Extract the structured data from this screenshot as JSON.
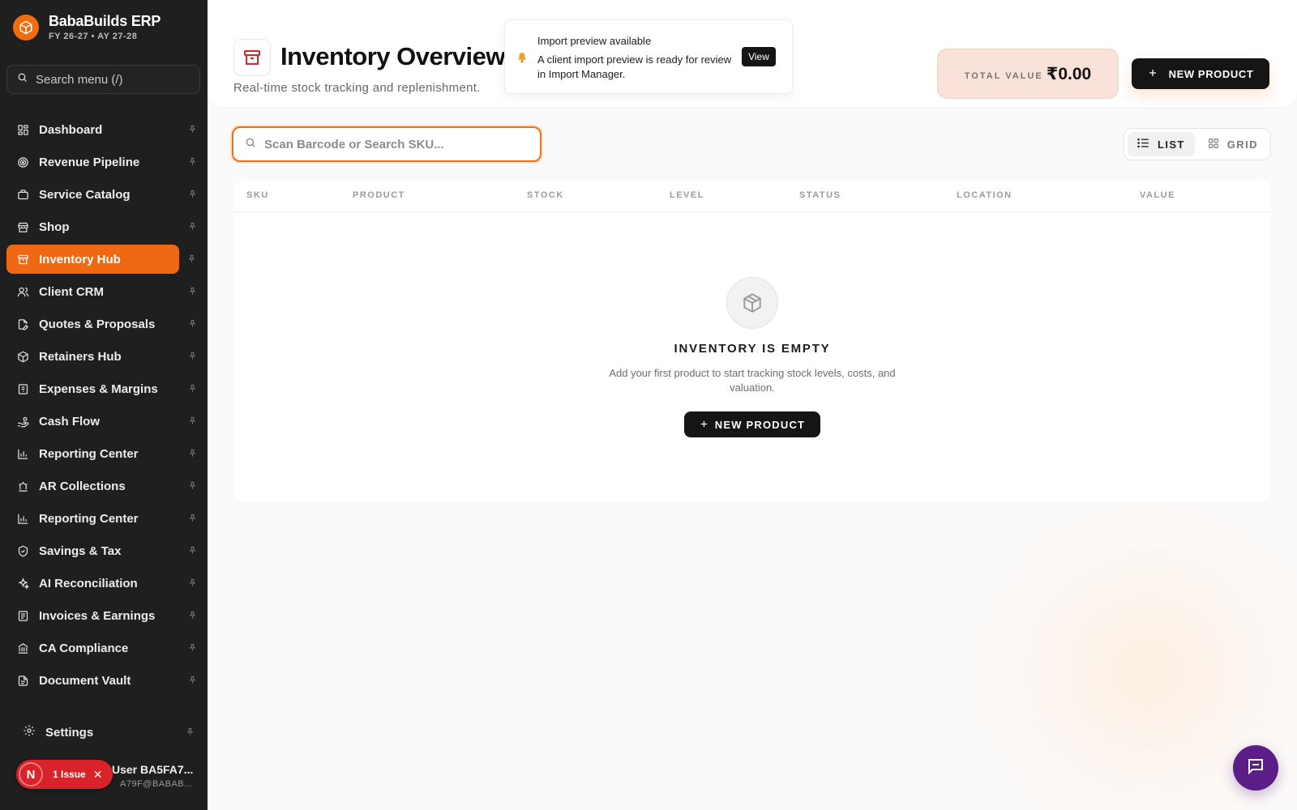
{
  "app": {
    "name": "BabaBuilds ERP",
    "fiscal_year": "FY 26-27 • AY 27-28",
    "logo_icon": "cube-icon",
    "accent_color": "#ef6812"
  },
  "sidebar": {
    "search_placeholder": "Search menu (/)",
    "items": [
      {
        "label": "Dashboard",
        "icon": "dashboard-grid-icon"
      },
      {
        "label": "Revenue Pipeline",
        "icon": "target-icon"
      },
      {
        "label": "Service Catalog",
        "icon": "briefcase-icon"
      },
      {
        "label": "Shop",
        "icon": "store-icon"
      },
      {
        "label": "Inventory Hub",
        "icon": "archive-box-icon",
        "active": true
      },
      {
        "label": "Client CRM",
        "icon": "users-icon"
      },
      {
        "label": "Quotes & Proposals",
        "icon": "file-edit-icon"
      },
      {
        "label": "Retainers Hub",
        "icon": "package-icon"
      },
      {
        "label": "Expenses & Margins",
        "icon": "receipt-icon"
      },
      {
        "label": "Cash Flow",
        "icon": "hand-coins-icon"
      },
      {
        "label": "Reporting Center",
        "icon": "bar-chart-icon"
      },
      {
        "label": "AR Collections",
        "icon": "alarm-icon"
      },
      {
        "label": "Reporting Center",
        "icon": "bar-chart-icon"
      },
      {
        "label": "Savings & Tax",
        "icon": "shield-check-icon"
      },
      {
        "label": "AI Reconciliation",
        "icon": "sparkles-icon"
      },
      {
        "label": "Invoices & Earnings",
        "icon": "file-text-icon"
      },
      {
        "label": "CA Compliance",
        "icon": "bank-icon"
      },
      {
        "label": "Document Vault",
        "icon": "document-icon"
      }
    ],
    "settings_label": "Settings",
    "user": {
      "name": "User BA5FA7...",
      "email": "A79F@BABAB...",
      "avatar_letter": "N"
    },
    "issue_badge": "1 Issue"
  },
  "header": {
    "title": "Inventory Overview",
    "subtitle": "Real-time stock tracking and replenishment.",
    "total_value_label": "TOTAL VALUE",
    "total_value": "₹0.00",
    "new_product_label": "NEW PRODUCT"
  },
  "toast": {
    "title": "Import preview available",
    "body": "A client import preview is ready for review in Import Manager.",
    "action_label": "View"
  },
  "search": {
    "placeholder": "Scan Barcode or Search SKU..."
  },
  "view_toggle": {
    "list_label": "LIST",
    "grid_label": "GRID",
    "selected": "LIST"
  },
  "table": {
    "columns": [
      "SKU",
      "PRODUCT",
      "STOCK",
      "LEVEL",
      "STATUS",
      "LOCATION",
      "VALUE"
    ],
    "rows": []
  },
  "empty_state": {
    "title": "INVENTORY IS EMPTY",
    "description": "Add your first product to start tracking stock levels, costs, and valuation.",
    "button_label": "NEW PRODUCT"
  }
}
